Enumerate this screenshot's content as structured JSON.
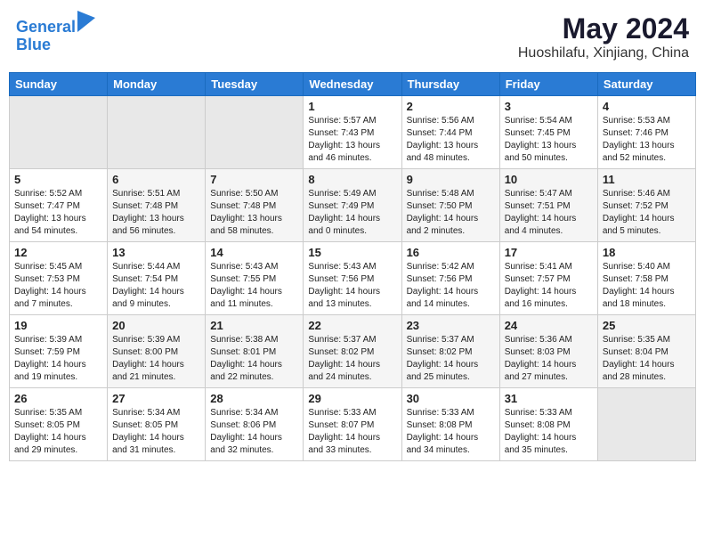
{
  "logo": {
    "line1": "General",
    "line2": "Blue"
  },
  "title": {
    "month": "May 2024",
    "location": "Huoshilafu, Xinjiang, China"
  },
  "weekdays": [
    "Sunday",
    "Monday",
    "Tuesday",
    "Wednesday",
    "Thursday",
    "Friday",
    "Saturday"
  ],
  "weeks": [
    [
      {
        "day": "",
        "empty": true
      },
      {
        "day": "",
        "empty": true
      },
      {
        "day": "",
        "empty": true
      },
      {
        "day": "1",
        "sunrise": "5:57 AM",
        "sunset": "7:43 PM",
        "daylight": "13 hours and 46 minutes."
      },
      {
        "day": "2",
        "sunrise": "5:56 AM",
        "sunset": "7:44 PM",
        "daylight": "13 hours and 48 minutes."
      },
      {
        "day": "3",
        "sunrise": "5:54 AM",
        "sunset": "7:45 PM",
        "daylight": "13 hours and 50 minutes."
      },
      {
        "day": "4",
        "sunrise": "5:53 AM",
        "sunset": "7:46 PM",
        "daylight": "13 hours and 52 minutes."
      }
    ],
    [
      {
        "day": "5",
        "sunrise": "5:52 AM",
        "sunset": "7:47 PM",
        "daylight": "13 hours and 54 minutes."
      },
      {
        "day": "6",
        "sunrise": "5:51 AM",
        "sunset": "7:48 PM",
        "daylight": "13 hours and 56 minutes."
      },
      {
        "day": "7",
        "sunrise": "5:50 AM",
        "sunset": "7:48 PM",
        "daylight": "13 hours and 58 minutes."
      },
      {
        "day": "8",
        "sunrise": "5:49 AM",
        "sunset": "7:49 PM",
        "daylight": "14 hours and 0 minutes."
      },
      {
        "day": "9",
        "sunrise": "5:48 AM",
        "sunset": "7:50 PM",
        "daylight": "14 hours and 2 minutes."
      },
      {
        "day": "10",
        "sunrise": "5:47 AM",
        "sunset": "7:51 PM",
        "daylight": "14 hours and 4 minutes."
      },
      {
        "day": "11",
        "sunrise": "5:46 AM",
        "sunset": "7:52 PM",
        "daylight": "14 hours and 5 minutes."
      }
    ],
    [
      {
        "day": "12",
        "sunrise": "5:45 AM",
        "sunset": "7:53 PM",
        "daylight": "14 hours and 7 minutes."
      },
      {
        "day": "13",
        "sunrise": "5:44 AM",
        "sunset": "7:54 PM",
        "daylight": "14 hours and 9 minutes."
      },
      {
        "day": "14",
        "sunrise": "5:43 AM",
        "sunset": "7:55 PM",
        "daylight": "14 hours and 11 minutes."
      },
      {
        "day": "15",
        "sunrise": "5:43 AM",
        "sunset": "7:56 PM",
        "daylight": "14 hours and 13 minutes."
      },
      {
        "day": "16",
        "sunrise": "5:42 AM",
        "sunset": "7:56 PM",
        "daylight": "14 hours and 14 minutes."
      },
      {
        "day": "17",
        "sunrise": "5:41 AM",
        "sunset": "7:57 PM",
        "daylight": "14 hours and 16 minutes."
      },
      {
        "day": "18",
        "sunrise": "5:40 AM",
        "sunset": "7:58 PM",
        "daylight": "14 hours and 18 minutes."
      }
    ],
    [
      {
        "day": "19",
        "sunrise": "5:39 AM",
        "sunset": "7:59 PM",
        "daylight": "14 hours and 19 minutes."
      },
      {
        "day": "20",
        "sunrise": "5:39 AM",
        "sunset": "8:00 PM",
        "daylight": "14 hours and 21 minutes."
      },
      {
        "day": "21",
        "sunrise": "5:38 AM",
        "sunset": "8:01 PM",
        "daylight": "14 hours and 22 minutes."
      },
      {
        "day": "22",
        "sunrise": "5:37 AM",
        "sunset": "8:02 PM",
        "daylight": "14 hours and 24 minutes."
      },
      {
        "day": "23",
        "sunrise": "5:37 AM",
        "sunset": "8:02 PM",
        "daylight": "14 hours and 25 minutes."
      },
      {
        "day": "24",
        "sunrise": "5:36 AM",
        "sunset": "8:03 PM",
        "daylight": "14 hours and 27 minutes."
      },
      {
        "day": "25",
        "sunrise": "5:35 AM",
        "sunset": "8:04 PM",
        "daylight": "14 hours and 28 minutes."
      }
    ],
    [
      {
        "day": "26",
        "sunrise": "5:35 AM",
        "sunset": "8:05 PM",
        "daylight": "14 hours and 29 minutes."
      },
      {
        "day": "27",
        "sunrise": "5:34 AM",
        "sunset": "8:05 PM",
        "daylight": "14 hours and 31 minutes."
      },
      {
        "day": "28",
        "sunrise": "5:34 AM",
        "sunset": "8:06 PM",
        "daylight": "14 hours and 32 minutes."
      },
      {
        "day": "29",
        "sunrise": "5:33 AM",
        "sunset": "8:07 PM",
        "daylight": "14 hours and 33 minutes."
      },
      {
        "day": "30",
        "sunrise": "5:33 AM",
        "sunset": "8:08 PM",
        "daylight": "14 hours and 34 minutes."
      },
      {
        "day": "31",
        "sunrise": "5:33 AM",
        "sunset": "8:08 PM",
        "daylight": "14 hours and 35 minutes."
      },
      {
        "day": "",
        "empty": true
      }
    ]
  ],
  "labels": {
    "sunrise": "Sunrise:",
    "sunset": "Sunset:",
    "daylight": "Daylight hours"
  }
}
